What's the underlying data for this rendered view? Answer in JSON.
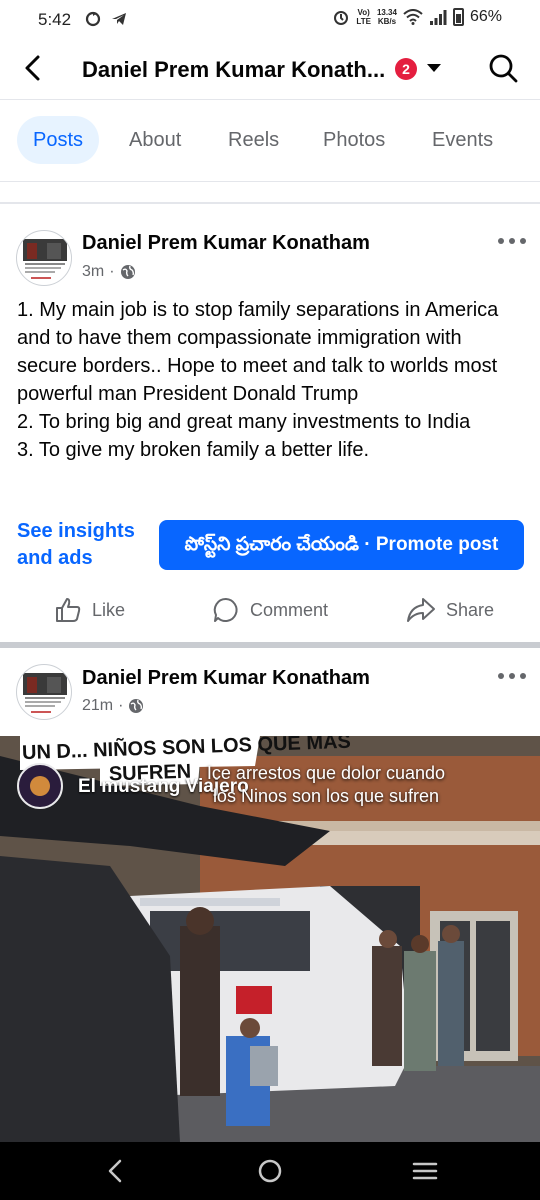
{
  "status": {
    "time": "5:42",
    "net_top": "Vo)",
    "net_bottom": "LTE",
    "speed_top": "13.34",
    "speed_bottom": "KB/s",
    "battery": "66%"
  },
  "header": {
    "title": "Daniel Prem Kumar Konath...",
    "badge": "2"
  },
  "tabs": [
    "Posts",
    "About",
    "Reels",
    "Photos",
    "Events"
  ],
  "posts": [
    {
      "author": "Daniel Prem Kumar Konatham",
      "time": "3m",
      "sep": "·",
      "text": "1. My main job is to stop family separations in America and to have them compassionate immigration with secure borders.. Hope to meet and talk to worlds most powerful man President Donald Trump\n2. To bring big and great many investments to India\n3. To give my broken family a better life.",
      "insights": "See insights and ads",
      "promote": "పోస్ట్‌ని ప్రచారం చేయండి · Promote post",
      "actions": [
        "Like",
        "Comment",
        "Share"
      ]
    },
    {
      "author": "Daniel Prem Kumar Konatham",
      "time": "21m",
      "sep": "·",
      "video": {
        "banner_top": "UN D... NIÑOS SON LOS QUE MAS",
        "banner_bottom": "SUFREN",
        "channel": "El mustang Viajero",
        "caption": "Ice arrestos que dolor cuando los Ninos son los que sufren"
      }
    }
  ],
  "colors": {
    "accent": "#0866ff",
    "badge": "#e41e3f",
    "muted": "#65676b"
  }
}
